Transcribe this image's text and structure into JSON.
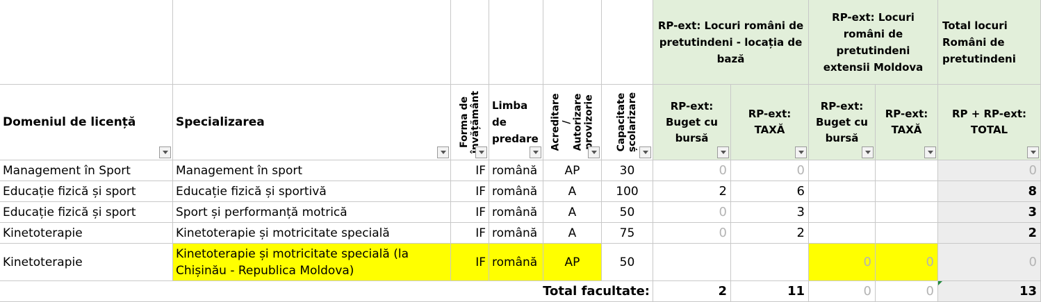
{
  "group_headers": {
    "base": "RP-ext: Locuri români de pretutindeni - locația de bază",
    "moldova": "RP-ext: Locuri români de pretutindeni extensii Moldova",
    "total": "Total locuri Români de pretutindeni"
  },
  "columns": {
    "domeniu": "Domeniul de licență",
    "specializare": "Specializarea",
    "forma": "Forma de învățământ",
    "limba": "Limba de predare",
    "acreditare": "Acreditare / Autorizare provizorie",
    "capacitate": "Capacitate școlarizare",
    "base_buget": "RP-ext: Buget cu bursă",
    "base_taxa": "RP-ext: TAXĂ",
    "md_buget": "RP-ext: Buget cu bursă",
    "md_taxa": "RP-ext: TAXĂ",
    "total": "RP + RP-ext: TOTAL"
  },
  "rows": [
    {
      "domeniu": "Management în Sport",
      "specializare": "Management în sport",
      "forma": "IF",
      "limba": "română",
      "acreditare": "AP",
      "capacitate": "30",
      "base_buget": "0",
      "base_taxa": "0",
      "md_buget": "",
      "md_taxa": "",
      "total": "0"
    },
    {
      "domeniu": "Educație fizică și sport",
      "specializare": "Educație fizică și sportivă",
      "forma": "IF",
      "limba": "română",
      "acreditare": "A",
      "capacitate": "100",
      "base_buget": "2",
      "base_taxa": "6",
      "md_buget": "",
      "md_taxa": "",
      "total": "8"
    },
    {
      "domeniu": "Educație fizică și sport",
      "specializare": "Sport și performanță motrică",
      "forma": "IF",
      "limba": "română",
      "acreditare": "A",
      "capacitate": "50",
      "base_buget": "0",
      "base_taxa": "3",
      "md_buget": "",
      "md_taxa": "",
      "total": "3"
    },
    {
      "domeniu": "Kinetoterapie",
      "specializare": "Kinetoterapie și motricitate specială",
      "forma": "IF",
      "limba": "română",
      "acreditare": "A",
      "capacitate": "75",
      "base_buget": "0",
      "base_taxa": "2",
      "md_buget": "",
      "md_taxa": "",
      "total": "2"
    },
    {
      "domeniu": "Kinetoterapie",
      "specializare": "Kinetoterapie și motricitate specială (la Chișinău - Republica Moldova)",
      "forma": "IF",
      "limba": "română",
      "acreditare": "AP",
      "capacitate": "50",
      "base_buget": "",
      "base_taxa": "",
      "md_buget": "0",
      "md_taxa": "0",
      "total": "0"
    }
  ],
  "totals": {
    "label": "Total facultate:",
    "base_buget": "2",
    "base_taxa": "11",
    "md_buget": "0",
    "md_taxa": "0",
    "total": "13"
  },
  "colors": {
    "header_green": "#e2efda",
    "total_gray": "#ededed",
    "highlight_yellow": "#ffff00",
    "muted_zero": "#b4b4b4"
  },
  "icons": {
    "filter": "filter-dropdown-icon"
  }
}
